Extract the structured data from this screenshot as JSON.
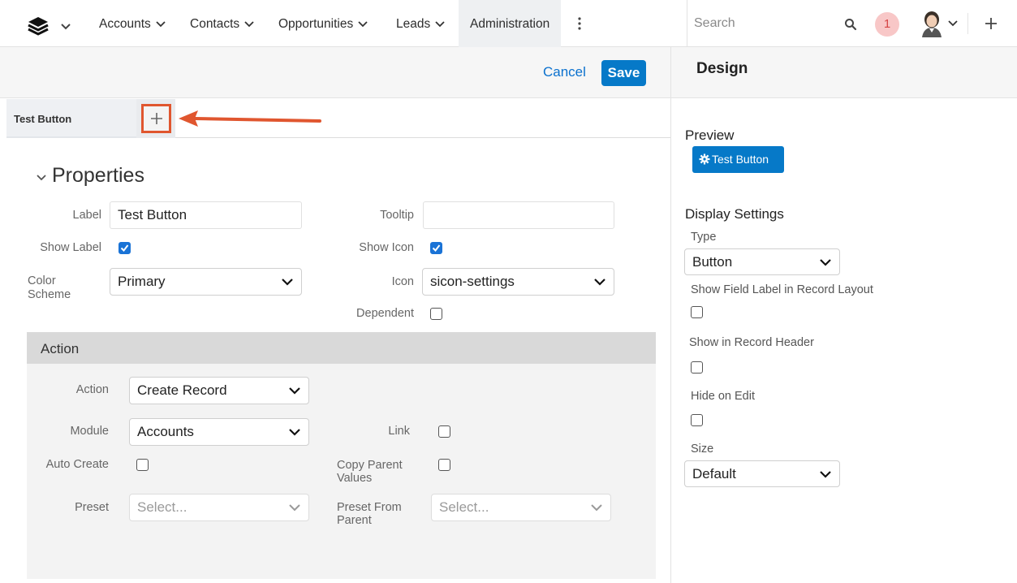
{
  "nav": {
    "items": [
      {
        "label": "Accounts"
      },
      {
        "label": "Contacts"
      },
      {
        "label": "Opportunities"
      },
      {
        "label": "Leads"
      }
    ],
    "active_item": "Administration",
    "search_placeholder": "Search",
    "notification_count": "1"
  },
  "header": {
    "cancel_label": "Cancel",
    "save_label": "Save"
  },
  "tabs": {
    "active_label": "Test Button",
    "add_icon": "plus-icon"
  },
  "properties": {
    "title": "Properties",
    "label_label": "Label",
    "label_value": "Test Button",
    "tooltip_label": "Tooltip",
    "tooltip_value": "",
    "show_label_label": "Show Label",
    "show_label_checked": true,
    "show_icon_label": "Show Icon",
    "show_icon_checked": true,
    "color_scheme_label": "Color Scheme",
    "color_scheme_value": "Primary",
    "icon_label": "Icon",
    "icon_value": "sicon-settings",
    "dependent_label": "Dependent",
    "dependent_checked": false
  },
  "action": {
    "title": "Action",
    "action_label": "Action",
    "action_value": "Create Record",
    "module_label": "Module",
    "module_value": "Accounts",
    "link_label": "Link",
    "link_checked": false,
    "auto_create_label": "Auto Create",
    "auto_create_checked": false,
    "copy_parent_label": "Copy Parent Values",
    "copy_parent_checked": false,
    "preset_label": "Preset",
    "preset_placeholder": "Select...",
    "preset_parent_label": "Preset From Parent",
    "preset_parent_placeholder": "Select..."
  },
  "design": {
    "title": "Design",
    "preview_label": "Preview",
    "preview_button_label": "Test Button",
    "display_settings_label": "Display Settings",
    "type_label": "Type",
    "type_value": "Button",
    "show_field_label": "Show Field Label in Record Layout",
    "show_in_header_label": "Show in Record Header",
    "hide_on_edit_label": "Hide on Edit",
    "size_label": "Size",
    "size_value": "Default"
  },
  "colors": {
    "primary": "#0679c8",
    "highlight": "#e0562f",
    "checkbox_checked": "#1a73d6"
  }
}
